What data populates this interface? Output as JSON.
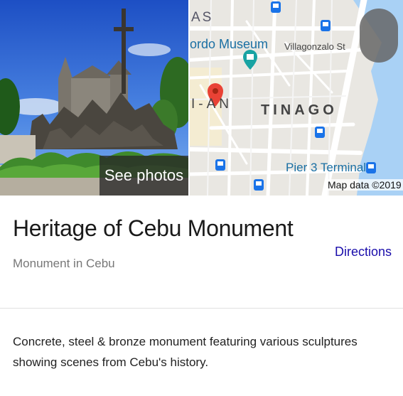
{
  "media": {
    "see_photos_label": "See photos"
  },
  "map": {
    "labels": {
      "as": "AS",
      "museum": "ordo Museum",
      "street": "Villagonzalo St",
      "district_left": "I-AN",
      "district": "TINAGO",
      "terminal": "Pier 3 Terminal",
      "attribution": "Map data ©2019"
    },
    "colors": {
      "water": "#a9d1f5",
      "road": "#ffffff",
      "land": "#e9e7e2",
      "pin": "#e94235",
      "transit": "#1a73e8",
      "museum_pin": "#18a3a3"
    }
  },
  "place": {
    "title": "Heritage of Cebu Monument",
    "category": "Monument in Cebu",
    "directions_label": "Directions",
    "description": "Concrete, steel & bronze monument featuring various sculptures showing scenes from Cebu's history."
  },
  "colors": {
    "link": "#1a0dab",
    "divider": "#e0e0e0"
  }
}
